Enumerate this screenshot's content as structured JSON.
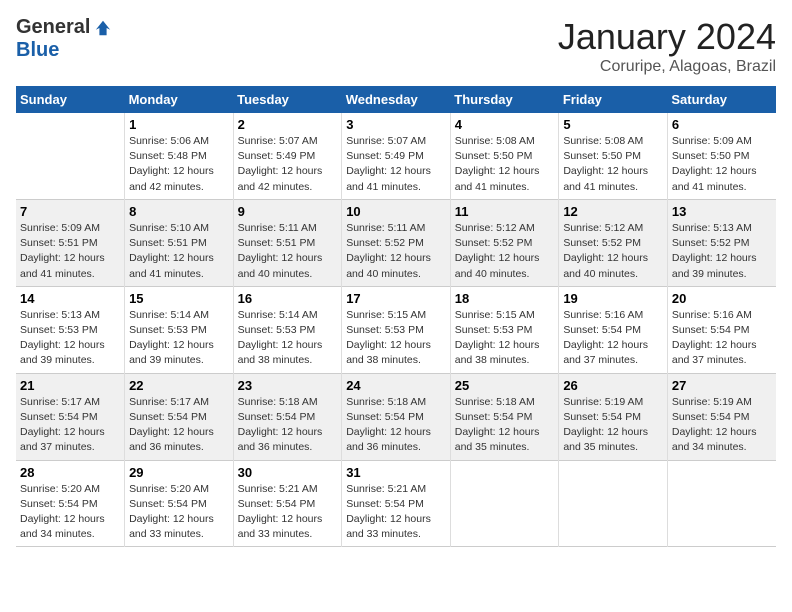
{
  "header": {
    "logo_general": "General",
    "logo_blue": "Blue",
    "title": "January 2024",
    "location": "Coruripe, Alagoas, Brazil"
  },
  "calendar": {
    "days_of_week": [
      "Sunday",
      "Monday",
      "Tuesday",
      "Wednesday",
      "Thursday",
      "Friday",
      "Saturday"
    ],
    "weeks": [
      [
        {
          "day": "",
          "content": ""
        },
        {
          "day": "1",
          "content": "Sunrise: 5:06 AM\nSunset: 5:48 PM\nDaylight: 12 hours\nand 42 minutes."
        },
        {
          "day": "2",
          "content": "Sunrise: 5:07 AM\nSunset: 5:49 PM\nDaylight: 12 hours\nand 42 minutes."
        },
        {
          "day": "3",
          "content": "Sunrise: 5:07 AM\nSunset: 5:49 PM\nDaylight: 12 hours\nand 41 minutes."
        },
        {
          "day": "4",
          "content": "Sunrise: 5:08 AM\nSunset: 5:50 PM\nDaylight: 12 hours\nand 41 minutes."
        },
        {
          "day": "5",
          "content": "Sunrise: 5:08 AM\nSunset: 5:50 PM\nDaylight: 12 hours\nand 41 minutes."
        },
        {
          "day": "6",
          "content": "Sunrise: 5:09 AM\nSunset: 5:50 PM\nDaylight: 12 hours\nand 41 minutes."
        }
      ],
      [
        {
          "day": "7",
          "content": "Sunrise: 5:09 AM\nSunset: 5:51 PM\nDaylight: 12 hours\nand 41 minutes."
        },
        {
          "day": "8",
          "content": "Sunrise: 5:10 AM\nSunset: 5:51 PM\nDaylight: 12 hours\nand 41 minutes."
        },
        {
          "day": "9",
          "content": "Sunrise: 5:11 AM\nSunset: 5:51 PM\nDaylight: 12 hours\nand 40 minutes."
        },
        {
          "day": "10",
          "content": "Sunrise: 5:11 AM\nSunset: 5:52 PM\nDaylight: 12 hours\nand 40 minutes."
        },
        {
          "day": "11",
          "content": "Sunrise: 5:12 AM\nSunset: 5:52 PM\nDaylight: 12 hours\nand 40 minutes."
        },
        {
          "day": "12",
          "content": "Sunrise: 5:12 AM\nSunset: 5:52 PM\nDaylight: 12 hours\nand 40 minutes."
        },
        {
          "day": "13",
          "content": "Sunrise: 5:13 AM\nSunset: 5:52 PM\nDaylight: 12 hours\nand 39 minutes."
        }
      ],
      [
        {
          "day": "14",
          "content": "Sunrise: 5:13 AM\nSunset: 5:53 PM\nDaylight: 12 hours\nand 39 minutes."
        },
        {
          "day": "15",
          "content": "Sunrise: 5:14 AM\nSunset: 5:53 PM\nDaylight: 12 hours\nand 39 minutes."
        },
        {
          "day": "16",
          "content": "Sunrise: 5:14 AM\nSunset: 5:53 PM\nDaylight: 12 hours\nand 38 minutes."
        },
        {
          "day": "17",
          "content": "Sunrise: 5:15 AM\nSunset: 5:53 PM\nDaylight: 12 hours\nand 38 minutes."
        },
        {
          "day": "18",
          "content": "Sunrise: 5:15 AM\nSunset: 5:53 PM\nDaylight: 12 hours\nand 38 minutes."
        },
        {
          "day": "19",
          "content": "Sunrise: 5:16 AM\nSunset: 5:54 PM\nDaylight: 12 hours\nand 37 minutes."
        },
        {
          "day": "20",
          "content": "Sunrise: 5:16 AM\nSunset: 5:54 PM\nDaylight: 12 hours\nand 37 minutes."
        }
      ],
      [
        {
          "day": "21",
          "content": "Sunrise: 5:17 AM\nSunset: 5:54 PM\nDaylight: 12 hours\nand 37 minutes."
        },
        {
          "day": "22",
          "content": "Sunrise: 5:17 AM\nSunset: 5:54 PM\nDaylight: 12 hours\nand 36 minutes."
        },
        {
          "day": "23",
          "content": "Sunrise: 5:18 AM\nSunset: 5:54 PM\nDaylight: 12 hours\nand 36 minutes."
        },
        {
          "day": "24",
          "content": "Sunrise: 5:18 AM\nSunset: 5:54 PM\nDaylight: 12 hours\nand 36 minutes."
        },
        {
          "day": "25",
          "content": "Sunrise: 5:18 AM\nSunset: 5:54 PM\nDaylight: 12 hours\nand 35 minutes."
        },
        {
          "day": "26",
          "content": "Sunrise: 5:19 AM\nSunset: 5:54 PM\nDaylight: 12 hours\nand 35 minutes."
        },
        {
          "day": "27",
          "content": "Sunrise: 5:19 AM\nSunset: 5:54 PM\nDaylight: 12 hours\nand 34 minutes."
        }
      ],
      [
        {
          "day": "28",
          "content": "Sunrise: 5:20 AM\nSunset: 5:54 PM\nDaylight: 12 hours\nand 34 minutes."
        },
        {
          "day": "29",
          "content": "Sunrise: 5:20 AM\nSunset: 5:54 PM\nDaylight: 12 hours\nand 33 minutes."
        },
        {
          "day": "30",
          "content": "Sunrise: 5:21 AM\nSunset: 5:54 PM\nDaylight: 12 hours\nand 33 minutes."
        },
        {
          "day": "31",
          "content": "Sunrise: 5:21 AM\nSunset: 5:54 PM\nDaylight: 12 hours\nand 33 minutes."
        },
        {
          "day": "",
          "content": ""
        },
        {
          "day": "",
          "content": ""
        },
        {
          "day": "",
          "content": ""
        }
      ]
    ]
  }
}
